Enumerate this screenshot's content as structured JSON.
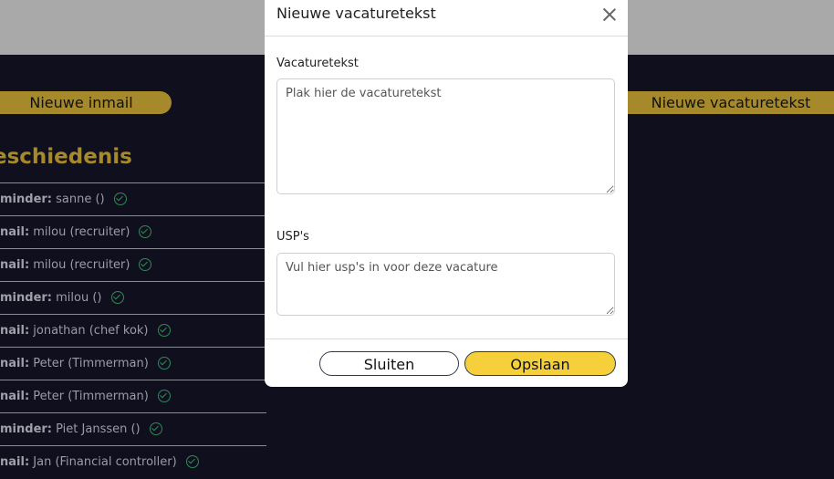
{
  "background": {
    "new_inmail_label": "Nieuwe inmail",
    "new_vacancy_label": "Nieuwe vacaturetekst",
    "history_title": "eschiedenis",
    "history": [
      {
        "type": "minder:",
        "name": " sanne ()"
      },
      {
        "type": "nail:",
        "name": " milou (recruiter)"
      },
      {
        "type": "nail:",
        "name": " milou (recruiter)"
      },
      {
        "type": "minder:",
        "name": " milou ()"
      },
      {
        "type": "nail:",
        "name": " jonathan (chef kok)"
      },
      {
        "type": "nail:",
        "name": " Peter (Timmerman)"
      },
      {
        "type": "nail:",
        "name": " Peter (Timmerman)"
      },
      {
        "type": "minder:",
        "name": " Piet Janssen ()"
      },
      {
        "type": "nail:",
        "name": " Jan (Financial controller)"
      }
    ]
  },
  "modal": {
    "title": "Nieuwe vacaturetekst",
    "vacancy_label": "Vacaturetekst",
    "vacancy_placeholder": "Plak hier de vacaturetekst",
    "vacancy_value": "",
    "usp_label": "USP's",
    "usp_placeholder": "Vul hier usp's in voor deze vacature",
    "usp_value": "",
    "close_label": "Sluiten",
    "save_label": "Opslaan"
  }
}
